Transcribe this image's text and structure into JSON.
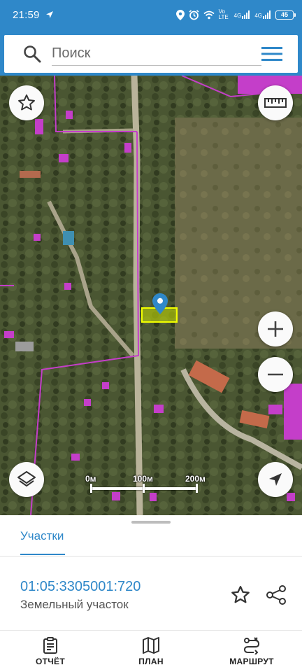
{
  "status_bar": {
    "time": "21:59",
    "net_volte": "Vo LTE",
    "net_4g_1": "4G",
    "net_4g_2": "4G",
    "battery": "45"
  },
  "search": {
    "placeholder": "Поиск",
    "search_icon": "search-icon",
    "menu_icon": "hamburger-menu-icon"
  },
  "map": {
    "favorite_icon": "star-outline-icon",
    "ruler_icon": "ruler-icon",
    "zoom_in_icon": "plus-icon",
    "zoom_out_icon": "minus-icon",
    "layers_icon": "layers-icon",
    "location_icon": "navigation-arrow-icon",
    "marker_icon": "map-marker-icon",
    "scale_labels": [
      "0м",
      "100м",
      "200м"
    ],
    "colors": {
      "boundary": "#c43ec9",
      "parcel": "#c8e000",
      "marker": "#2f88c9"
    }
  },
  "sheet": {
    "tab_label": "Участки",
    "parcel_id": "01:05:3305001:720",
    "parcel_type": "Земельный участок"
  },
  "bottom_nav": {
    "items": [
      {
        "label": "ОТЧЁТ",
        "icon": "clipboard-icon"
      },
      {
        "label": "ПЛАН",
        "icon": "map-icon"
      },
      {
        "label": "МАРШРУТ",
        "icon": "route-icon"
      }
    ]
  },
  "colors": {
    "primary": "#2f88c9",
    "text_secondary": "#555555"
  }
}
